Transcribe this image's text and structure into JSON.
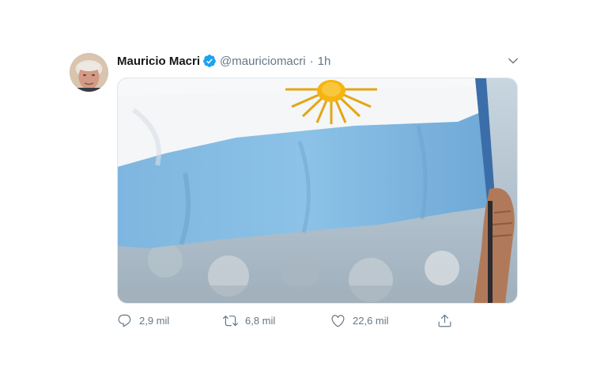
{
  "tweet": {
    "author_name": "Mauricio Macri",
    "handle": "@mauriciomacri",
    "separator": "·",
    "time": "1h",
    "verified": true,
    "verified_color": "#1da1f2",
    "media": {
      "subject": "argentina-flag",
      "flag_light_blue": "#75aadb",
      "sun_color": "#f6b40e"
    },
    "actions": {
      "reply_count": "2,9 mil",
      "retweet_count": "6,8 mil",
      "like_count": "22,6 mil"
    },
    "icons": {
      "reply": "reply-icon",
      "retweet": "retweet-icon",
      "like": "heart-icon",
      "share": "share-icon",
      "more": "chevron-down-icon",
      "verified": "verified-badge-icon"
    },
    "colors": {
      "name": "#14171a",
      "secondary": "#657786"
    }
  }
}
